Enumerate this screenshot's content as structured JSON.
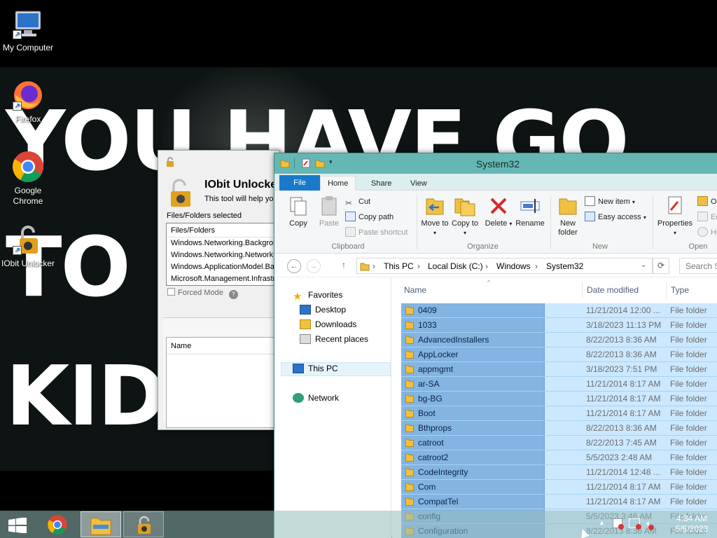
{
  "desktop": {
    "wallpaper_lines": [
      "YOU HAVE GO",
      "TO",
      "KID"
    ],
    "icons": [
      {
        "label": "My Computer",
        "icon": "computer-icon"
      },
      {
        "label": "Firefox",
        "icon": "firefox-icon"
      },
      {
        "label": "Google Chrome",
        "icon": "chrome-icon"
      },
      {
        "label": "IObit Unlocker",
        "icon": "iobit-unlocker-icon"
      }
    ]
  },
  "iobit": {
    "app_name": "IObit Unlocker",
    "tagline": "This tool will help you",
    "files_selected_label": "Files/Folders selected",
    "list_header": "Files/Folders",
    "files": [
      "Windows.Networking.Backgrou",
      "Windows.Networking.Network",
      "Windows.ApplicationModel.Bac",
      "Microsoft.Management.Infrastr"
    ],
    "forced_mode_label": "Forced Mode",
    "forced_mode_checked": false,
    "help_icon": "?",
    "name_header": "Name"
  },
  "explorer": {
    "title": "System32",
    "tabs": [
      "File",
      "Home",
      "Share",
      "View"
    ],
    "ribbon": {
      "clipboard": {
        "group": "Clipboard",
        "copy": "Copy",
        "paste": "Paste",
        "cut": "Cut",
        "copy_path": "Copy path",
        "paste_shortcut": "Paste shortcut"
      },
      "organize": {
        "group": "Organize",
        "move_to": "Move to",
        "copy_to": "Copy to",
        "delete": "Delete",
        "rename": "Rename"
      },
      "new": {
        "group": "New",
        "new_folder": "New folder",
        "new_item": "New item",
        "easy_access": "Easy access"
      },
      "open": {
        "group": "Open",
        "properties": "Properties",
        "open": "O",
        "edit": "Ed",
        "history": "Hi"
      }
    },
    "address": {
      "crumbs": [
        "This PC",
        "Local Disk (C:)",
        "Windows",
        "System32"
      ],
      "search_placeholder": "Search Sy"
    },
    "nav": {
      "favorites": "Favorites",
      "items": [
        "Desktop",
        "Downloads",
        "Recent places"
      ],
      "this_pc": "This PC",
      "network": "Network"
    },
    "columns": {
      "name": "Name",
      "date": "Date modified",
      "type": "Type"
    },
    "files": [
      {
        "name": "0409",
        "date": "11/21/2014 12:00 ...",
        "type": "File folder"
      },
      {
        "name": "1033",
        "date": "3/18/2023 11:13 PM",
        "type": "File folder"
      },
      {
        "name": "AdvancedInstallers",
        "date": "8/22/2013 8:36 AM",
        "type": "File folder"
      },
      {
        "name": "AppLocker",
        "date": "8/22/2013 8:36 AM",
        "type": "File folder"
      },
      {
        "name": "appmgmt",
        "date": "3/18/2023 7:51 PM",
        "type": "File folder"
      },
      {
        "name": "ar-SA",
        "date": "11/21/2014 8:17 AM",
        "type": "File folder"
      },
      {
        "name": "bg-BG",
        "date": "11/21/2014 8:17 AM",
        "type": "File folder"
      },
      {
        "name": "Boot",
        "date": "11/21/2014 8:17 AM",
        "type": "File folder"
      },
      {
        "name": "Bthprops",
        "date": "8/22/2013 8:36 AM",
        "type": "File folder"
      },
      {
        "name": "catroot",
        "date": "8/22/2013 7:45 AM",
        "type": "File folder"
      },
      {
        "name": "catroot2",
        "date": "5/5/2023 2:48 AM",
        "type": "File folder"
      },
      {
        "name": "CodeIntegrity",
        "date": "11/21/2014 12:48 ...",
        "type": "File folder"
      },
      {
        "name": "Com",
        "date": "11/21/2014 8:17 AM",
        "type": "File folder"
      },
      {
        "name": "CompatTel",
        "date": "11/21/2014 8:17 AM",
        "type": "File folder"
      },
      {
        "name": "config",
        "date": "5/5/2023 3:46 AM",
        "type": "File folder"
      },
      {
        "name": "Configuration",
        "date": "8/22/2013 8:36 AM",
        "type": "File folder"
      }
    ]
  },
  "taskbar": {
    "apps": [
      "chrome-icon",
      "file-explorer-icon",
      "iobit-unlocker-icon"
    ],
    "time": "4:34 AM",
    "date": "5/5/2023"
  },
  "colors": {
    "accent": "#1979ca",
    "titlebar": "#65b7b4",
    "selection": "#cce8ff"
  }
}
